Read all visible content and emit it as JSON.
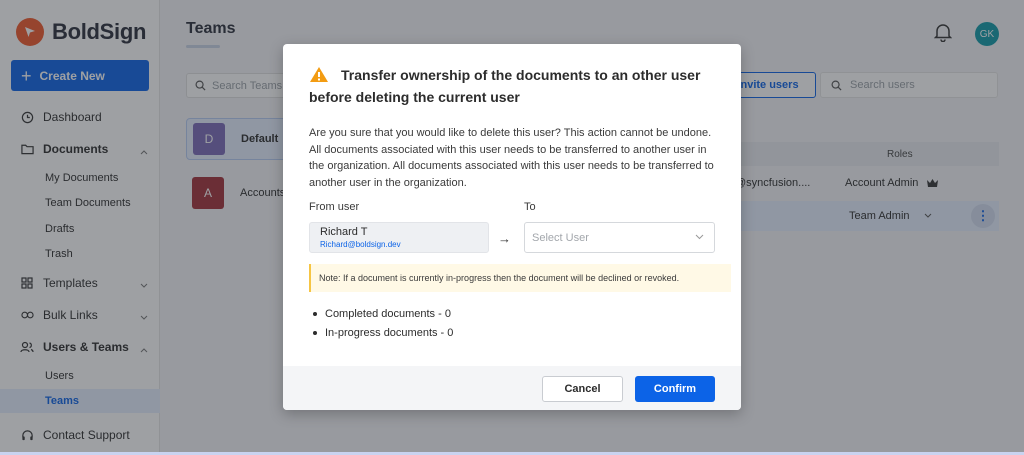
{
  "app": {
    "name": "BoldSign",
    "brand_color": "#f0582b",
    "accent_color": "#0c63e7"
  },
  "sidebar": {
    "create_label": "Create New",
    "items": [
      {
        "label": "Dashboard",
        "icon": "clock-icon"
      },
      {
        "label": "Documents",
        "icon": "folder-icon",
        "expanded": true
      },
      {
        "label": "Templates",
        "icon": "template-icon"
      },
      {
        "label": "Bulk Links",
        "icon": "link-icon"
      },
      {
        "label": "Users & Teams",
        "icon": "users-icon",
        "expanded": true
      },
      {
        "label": "Contact Support",
        "icon": "headset-icon"
      }
    ],
    "documents_sub": [
      "My Documents",
      "Team Documents",
      "Drafts",
      "Trash"
    ],
    "users_sub": [
      "Users",
      "Teams"
    ],
    "active_sub": "Teams"
  },
  "main": {
    "title": "Teams",
    "user_initials": "GK",
    "search_teams_placeholder": "Search Teams",
    "teams": [
      {
        "initial": "D",
        "name": "Default",
        "color": "#7b6bb8",
        "selected": true
      },
      {
        "initial": "A",
        "name": "Accounts",
        "color": "#a3303a",
        "selected": false
      }
    ],
    "invite_label": "Invite users",
    "search_users_placeholder": "Search users",
    "table": {
      "roles_header": "Roles",
      "rows": [
        {
          "email": "@syncfusion....",
          "role": "Account Admin"
        },
        {
          "role": "Team Admin"
        }
      ]
    }
  },
  "modal": {
    "title": "Transfer ownership of the documents to an other user before deleting the current user",
    "body": "Are you sure that you would like to delete this user? This action cannot be undone. All documents associated with this user needs to be transferred to another user in the organization. All documents associated with this user needs to be transferred to another user in the organization.",
    "from_label": "From user",
    "to_label": "To",
    "from_user": {
      "name": "Richard T",
      "email": "Richard@boldsign.dev"
    },
    "select_placeholder": "Select User",
    "note": "Note: If a document is currently in-progress then the document will be declined or revoked.",
    "stats": [
      "Completed documents - 0",
      "In-progress documents - 0"
    ],
    "cancel_label": "Cancel",
    "confirm_label": "Confirm"
  }
}
